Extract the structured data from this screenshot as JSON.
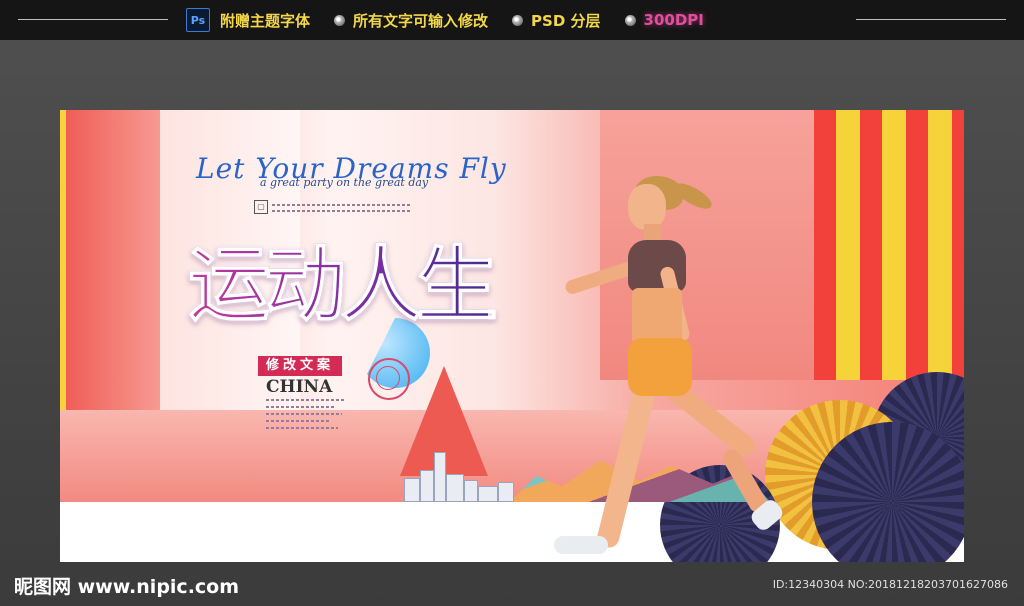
{
  "header": {
    "ps_badge": "Ps",
    "features": [
      "附赠主题字体",
      "所有文字可输入修改",
      "PSD 分层",
      "300DPI"
    ],
    "colors": {
      "feature_text": "#f3d64a",
      "dpi_text": "#e34d9d"
    }
  },
  "poster": {
    "script_title": "Let Your Dreams Fly",
    "script_subtitle": "a great party on the great day",
    "headline": "运动人生",
    "tag": "修改文案",
    "country": "CHINA",
    "colors": {
      "stripe_red": "#f2413a",
      "stripe_yellow": "#f7d33b",
      "headline": "#7a2fa5",
      "tag_bg": "#d42b56"
    }
  },
  "footer": {
    "brand": "昵图网 www.nipic.com",
    "id_text": "ID:12340304 NO:20181218203701627086"
  }
}
